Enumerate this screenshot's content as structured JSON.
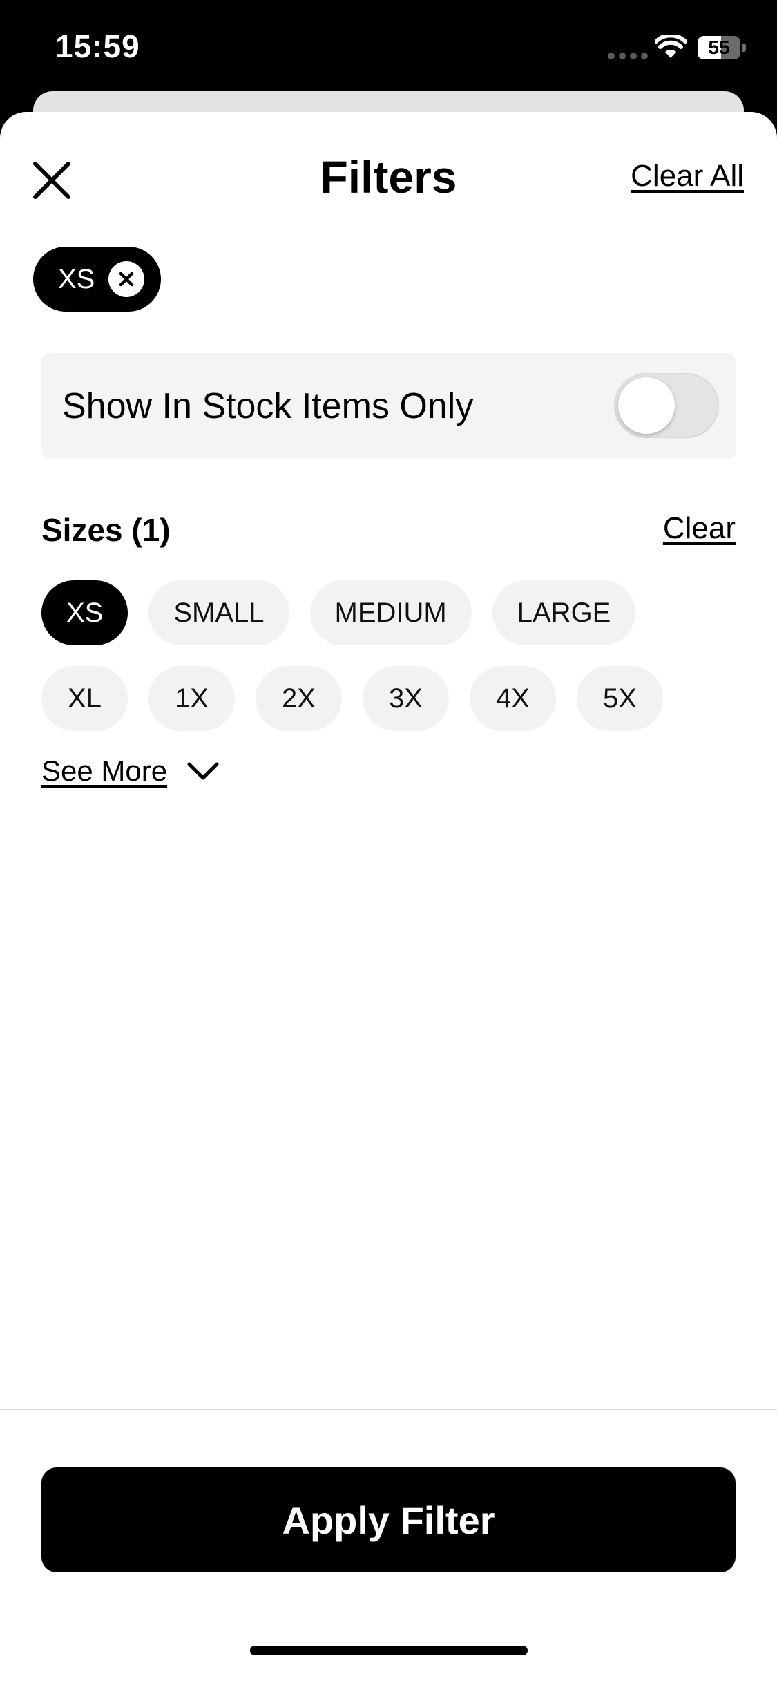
{
  "status_bar": {
    "time": "15:59",
    "battery_level": "55",
    "battery_fraction": 0.55
  },
  "header": {
    "title": "Filters",
    "close_icon": "close-icon",
    "clear_all_label": "Clear All"
  },
  "active_filters": [
    {
      "label": "XS",
      "remove_icon": "x-circle-icon"
    }
  ],
  "stock_toggle": {
    "label": "Show In Stock Items Only",
    "on": false
  },
  "sizes": {
    "title": "Sizes (1)",
    "clear_label": "Clear",
    "options": [
      {
        "label": "XS",
        "selected": true
      },
      {
        "label": "SMALL",
        "selected": false
      },
      {
        "label": "MEDIUM",
        "selected": false
      },
      {
        "label": "LARGE",
        "selected": false
      },
      {
        "label": "XL",
        "selected": false
      },
      {
        "label": "1X",
        "selected": false
      },
      {
        "label": "2X",
        "selected": false
      },
      {
        "label": "3X",
        "selected": false
      },
      {
        "label": "4X",
        "selected": false
      },
      {
        "label": "5X",
        "selected": false
      }
    ],
    "see_more_label": "See More",
    "see_more_icon": "chevron-down-icon"
  },
  "footer": {
    "apply_label": "Apply Filter"
  },
  "colors": {
    "primary": "#000000",
    "chip_bg": "#f2f2f2",
    "row_bg": "#f4f4f4"
  }
}
